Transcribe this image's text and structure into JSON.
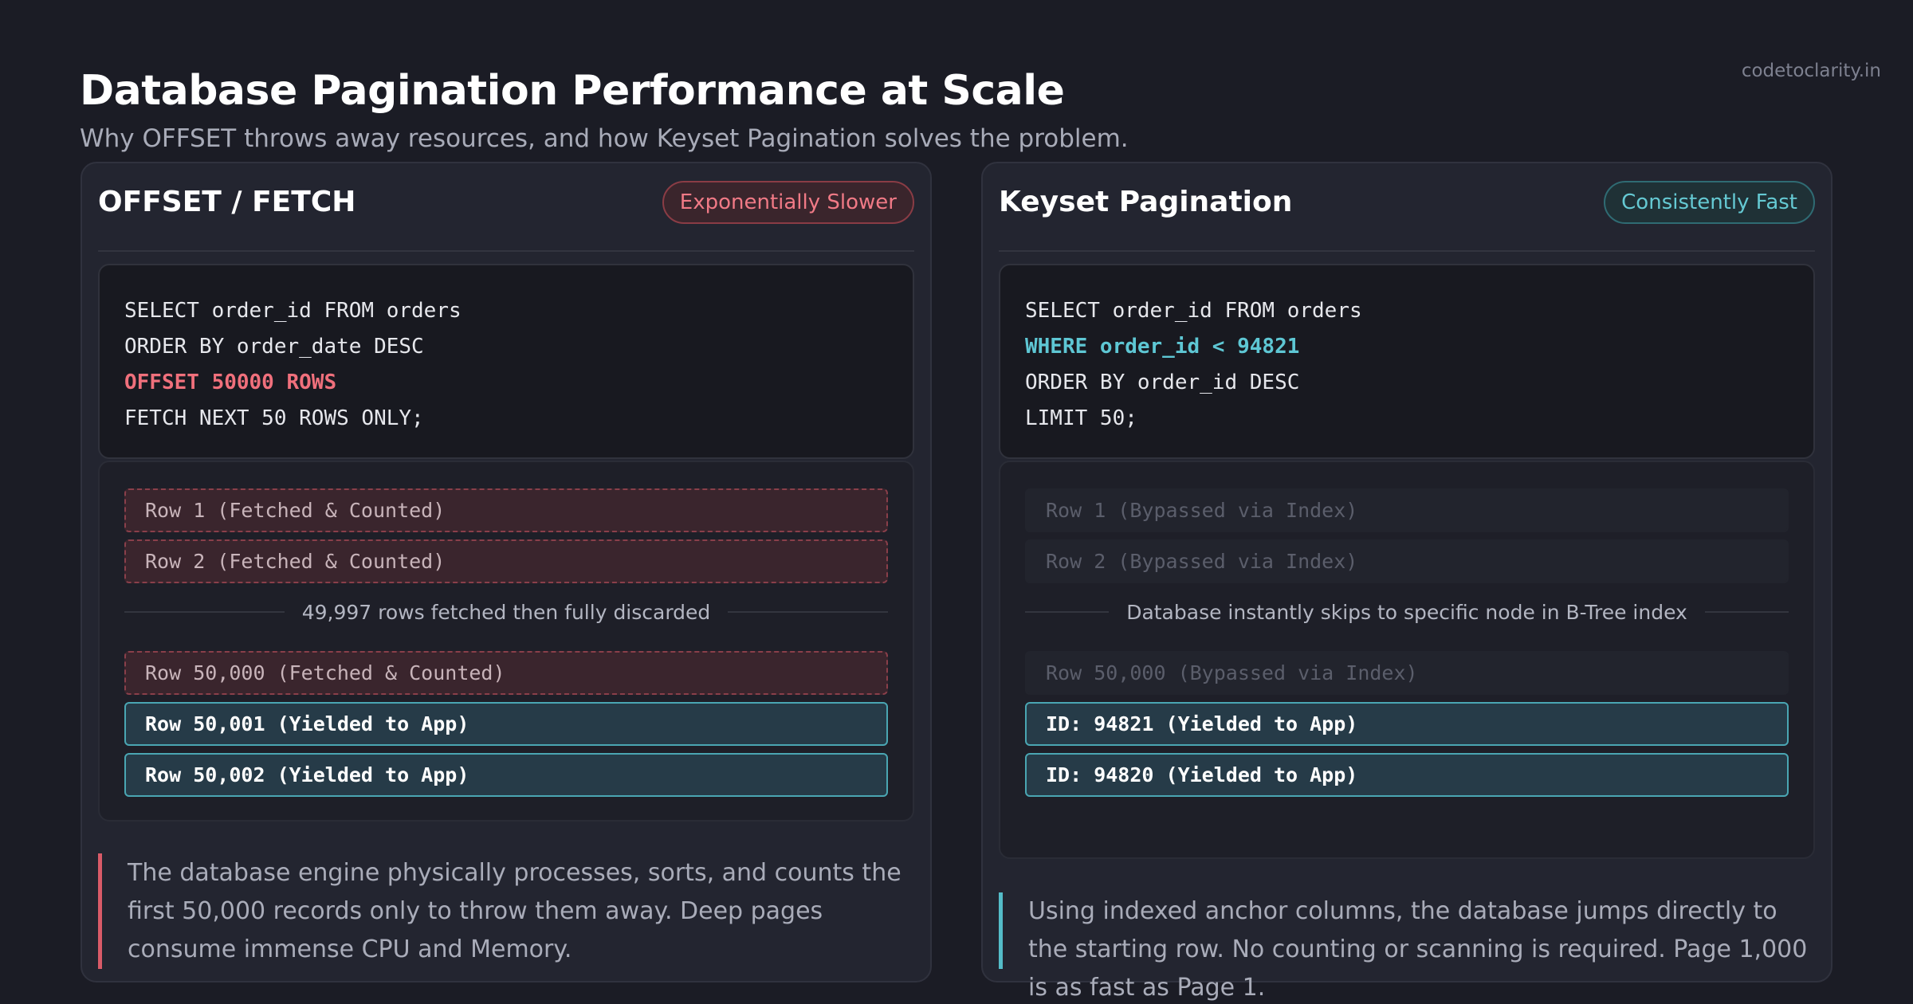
{
  "header": {
    "title": "Database Pagination Performance at Scale",
    "subtitle": "Why OFFSET throws away resources, and how Keyset Pagination solves the problem.",
    "watermark": "codetoclarity.in"
  },
  "offset_panel": {
    "title": "OFFSET / FETCH",
    "badge": "Exponentially Slower",
    "code": [
      "SELECT order_id FROM orders",
      "ORDER BY order_date DESC",
      "OFFSET 50000 ROWS",
      "FETCH NEXT 50 ROWS ONLY;"
    ],
    "rows": {
      "row1": "Row 1 (Fetched & Counted)",
      "row2": "Row 2 (Fetched & Counted)",
      "skip_text": "49,997 rows fetched then fully discarded",
      "row50000": "Row 50,000 (Fetched & Counted)",
      "yield1": "Row 50,001 (Yielded to App)",
      "yield2": "Row 50,002 (Yielded to App)"
    },
    "note": "The database engine physically processes, sorts, and counts the first 50,000 records only to throw them away. Deep pages consume immense CPU and Memory."
  },
  "keyset_panel": {
    "title": "Keyset Pagination",
    "badge": "Consistently Fast",
    "code": [
      "SELECT order_id FROM orders",
      "WHERE order_id < 94821",
      "ORDER BY order_id DESC",
      "LIMIT 50;"
    ],
    "rows": {
      "row1": "Row 1 (Bypassed via Index)",
      "row2": "Row 2 (Bypassed via Index)",
      "skip_text": "Database instantly skips to specific node in B-Tree index",
      "row50000": "Row 50,000 (Bypassed via Index)",
      "yield1": "ID: 94821 (Yielded to App)",
      "yield2": "ID: 94820 (Yielded to App)"
    },
    "note": "Using indexed anchor columns, the database jumps directly to the starting row. No counting or scanning is required. Page 1,000 is as fast as Page 1."
  },
  "colors": {
    "background": "#1b1c25",
    "slow_accent": "#f0707c",
    "fast_accent": "#5ec7d4",
    "yielded_row": "#263b48"
  }
}
